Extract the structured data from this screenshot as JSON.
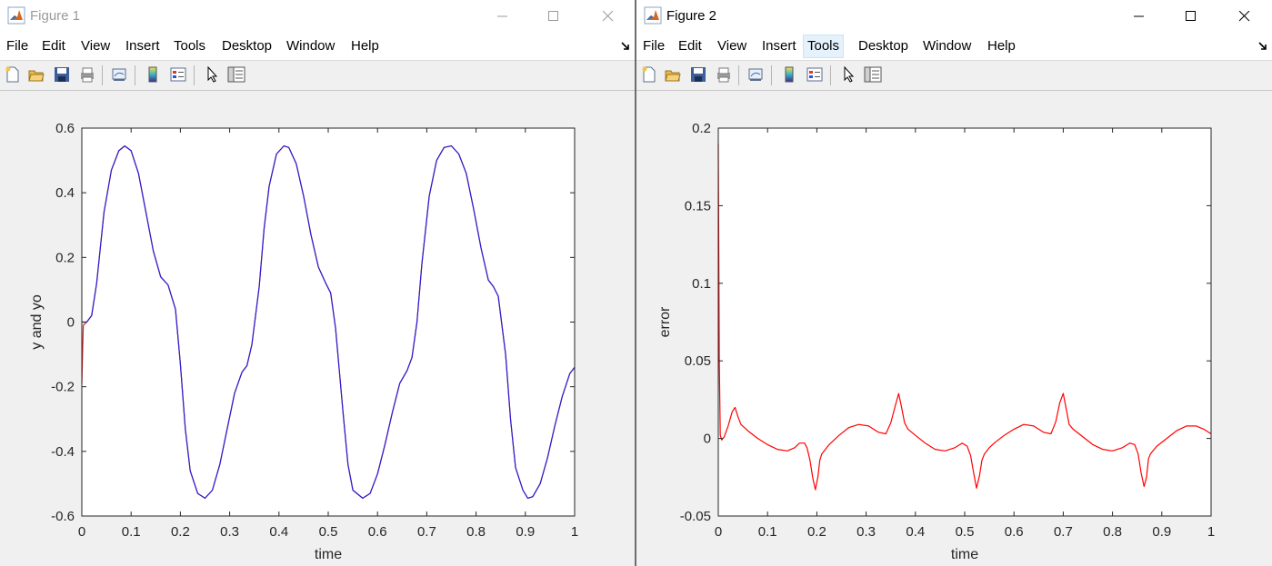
{
  "windows": [
    {
      "title": "Figure 1",
      "menu": [
        "File",
        "Edit",
        "View",
        "Insert",
        "Tools",
        "Desktop",
        "Window",
        "Help"
      ],
      "active_menu": null,
      "toolbar_icons": [
        "new-figure-icon",
        "open-file-icon",
        "save-icon",
        "print-icon",
        "link-plot-icon",
        "colorbar-icon",
        "legend-icon",
        "edit-plot-arrow-icon",
        "property-inspector-icon"
      ]
    },
    {
      "title": "Figure 2",
      "menu": [
        "File",
        "Edit",
        "View",
        "Insert",
        "Tools",
        "Desktop",
        "Window",
        "Help"
      ],
      "active_menu": "Tools",
      "toolbar_icons": [
        "new-figure-icon",
        "open-file-icon",
        "save-icon",
        "print-icon",
        "link-plot-icon",
        "colorbar-icon",
        "legend-icon",
        "edit-plot-arrow-icon",
        "property-inspector-icon"
      ]
    }
  ],
  "chart_data": [
    {
      "type": "line",
      "title": "",
      "xlabel": "time",
      "ylabel": "y and yo",
      "xlim": [
        0,
        1
      ],
      "ylim": [
        -0.6,
        0.6
      ],
      "xticks": [
        "0",
        "0.1",
        "0.2",
        "0.3",
        "0.4",
        "0.5",
        "0.6",
        "0.7",
        "0.8",
        "0.9",
        "1"
      ],
      "yticks": [
        "-0.6",
        "-0.4",
        "-0.2",
        "0",
        "0.2",
        "0.4",
        "0.6"
      ],
      "grid": false,
      "series": [
        {
          "color": "#e0201e",
          "x": [
            0,
            0.003,
            0.01,
            0.02,
            0.03,
            0.045,
            0.06,
            0.075,
            0.087,
            0.1,
            0.115,
            0.13,
            0.145,
            0.16,
            0.175,
            0.19,
            0.2,
            0.21,
            0.22,
            0.235,
            0.25,
            0.265,
            0.28,
            0.295,
            0.31,
            0.325,
            0.335,
            0.345,
            0.36,
            0.37,
            0.38,
            0.395,
            0.41,
            0.42,
            0.435,
            0.45,
            0.465,
            0.48,
            0.495,
            0.505,
            0.515,
            0.53,
            0.54,
            0.55,
            0.57,
            0.585,
            0.6,
            0.615,
            0.63,
            0.645,
            0.66,
            0.67,
            0.68,
            0.69,
            0.705,
            0.72,
            0.735,
            0.75,
            0.765,
            0.78,
            0.795,
            0.81,
            0.825,
            0.835,
            0.845,
            0.86,
            0.87,
            0.88,
            0.895,
            0.905,
            0.915,
            0.93,
            0.945,
            0.96,
            0.975,
            0.99,
            1.0
          ],
          "y": [
            -0.19,
            -0.01,
            0.0,
            0.02,
            0.12,
            0.34,
            0.47,
            0.53,
            0.545,
            0.53,
            0.46,
            0.34,
            0.22,
            0.14,
            0.115,
            0.04,
            -0.13,
            -0.33,
            -0.46,
            -0.53,
            -0.545,
            -0.52,
            -0.44,
            -0.33,
            -0.22,
            -0.155,
            -0.135,
            -0.07,
            0.11,
            0.29,
            0.42,
            0.52,
            0.545,
            0.54,
            0.49,
            0.39,
            0.27,
            0.17,
            0.12,
            0.09,
            -0.02,
            -0.28,
            -0.44,
            -0.52,
            -0.545,
            -0.53,
            -0.47,
            -0.38,
            -0.28,
            -0.19,
            -0.15,
            -0.11,
            0.0,
            0.18,
            0.39,
            0.5,
            0.54,
            0.545,
            0.52,
            0.46,
            0.35,
            0.23,
            0.13,
            0.11,
            0.08,
            -0.1,
            -0.3,
            -0.45,
            -0.52,
            -0.545,
            -0.54,
            -0.5,
            -0.42,
            -0.32,
            -0.23,
            -0.16,
            -0.14
          ]
        },
        {
          "color": "#2b1fd8",
          "x": [
            0,
            0.003,
            0.01,
            0.02,
            0.03,
            0.045,
            0.06,
            0.075,
            0.087,
            0.1,
            0.115,
            0.13,
            0.145,
            0.16,
            0.175,
            0.19,
            0.2,
            0.21,
            0.22,
            0.235,
            0.25,
            0.265,
            0.28,
            0.295,
            0.31,
            0.325,
            0.335,
            0.345,
            0.36,
            0.37,
            0.38,
            0.395,
            0.41,
            0.42,
            0.435,
            0.45,
            0.465,
            0.48,
            0.495,
            0.505,
            0.515,
            0.53,
            0.54,
            0.55,
            0.57,
            0.585,
            0.6,
            0.615,
            0.63,
            0.645,
            0.66,
            0.67,
            0.68,
            0.69,
            0.705,
            0.72,
            0.735,
            0.75,
            0.765,
            0.78,
            0.795,
            0.81,
            0.825,
            0.835,
            0.845,
            0.86,
            0.87,
            0.88,
            0.895,
            0.905,
            0.915,
            0.93,
            0.945,
            0.96,
            0.975,
            0.99,
            1.0
          ],
          "y": [
            0.0,
            0.0,
            0.0,
            0.02,
            0.12,
            0.34,
            0.47,
            0.53,
            0.545,
            0.53,
            0.46,
            0.34,
            0.22,
            0.14,
            0.115,
            0.04,
            -0.13,
            -0.33,
            -0.46,
            -0.53,
            -0.545,
            -0.52,
            -0.44,
            -0.33,
            -0.22,
            -0.155,
            -0.135,
            -0.07,
            0.11,
            0.29,
            0.42,
            0.52,
            0.545,
            0.54,
            0.49,
            0.39,
            0.27,
            0.17,
            0.12,
            0.09,
            -0.02,
            -0.28,
            -0.44,
            -0.52,
            -0.545,
            -0.53,
            -0.47,
            -0.38,
            -0.28,
            -0.19,
            -0.15,
            -0.11,
            0.0,
            0.18,
            0.39,
            0.5,
            0.54,
            0.545,
            0.52,
            0.46,
            0.35,
            0.23,
            0.13,
            0.11,
            0.08,
            -0.1,
            -0.3,
            -0.45,
            -0.52,
            -0.545,
            -0.54,
            -0.5,
            -0.42,
            -0.32,
            -0.23,
            -0.16,
            -0.14
          ]
        }
      ]
    },
    {
      "type": "line",
      "title": "",
      "xlabel": "time",
      "ylabel": "error",
      "xlim": [
        0,
        1
      ],
      "ylim": [
        -0.05,
        0.2
      ],
      "xticks": [
        "0",
        "0.1",
        "0.2",
        "0.3",
        "0.4",
        "0.5",
        "0.6",
        "0.7",
        "0.8",
        "0.9",
        "1"
      ],
      "yticks": [
        "-0.05",
        "0",
        "0.05",
        "0.1",
        "0.15",
        "0.2"
      ],
      "grid": false,
      "series": [
        {
          "color": "#ff0000",
          "x": [
            0,
            0.002,
            0.004,
            0.007,
            0.012,
            0.02,
            0.028,
            0.034,
            0.04,
            0.046,
            0.06,
            0.08,
            0.1,
            0.12,
            0.14,
            0.155,
            0.165,
            0.175,
            0.18,
            0.186,
            0.192,
            0.197,
            0.202,
            0.206,
            0.21,
            0.215,
            0.225,
            0.245,
            0.265,
            0.285,
            0.305,
            0.325,
            0.34,
            0.35,
            0.36,
            0.366,
            0.372,
            0.378,
            0.385,
            0.4,
            0.42,
            0.44,
            0.46,
            0.48,
            0.495,
            0.505,
            0.512,
            0.518,
            0.524,
            0.53,
            0.535,
            0.54,
            0.545,
            0.55,
            0.56,
            0.58,
            0.6,
            0.62,
            0.64,
            0.66,
            0.675,
            0.685,
            0.693,
            0.7,
            0.706,
            0.712,
            0.72,
            0.74,
            0.76,
            0.78,
            0.8,
            0.82,
            0.835,
            0.845,
            0.852,
            0.858,
            0.864,
            0.869,
            0.873,
            0.877,
            0.882,
            0.89,
            0.91,
            0.93,
            0.95,
            0.97,
            0.985,
            1.0
          ],
          "y": [
            0.19,
            0.05,
            0.002,
            -0.001,
            0.001,
            0.008,
            0.017,
            0.02,
            0.014,
            0.009,
            0.005,
            0.0,
            -0.004,
            -0.007,
            -0.008,
            -0.006,
            -0.003,
            -0.003,
            -0.006,
            -0.014,
            -0.026,
            -0.033,
            -0.025,
            -0.014,
            -0.01,
            -0.008,
            -0.004,
            0.002,
            0.007,
            0.009,
            0.008,
            0.004,
            0.003,
            0.01,
            0.022,
            0.029,
            0.02,
            0.01,
            0.006,
            0.002,
            -0.003,
            -0.007,
            -0.008,
            -0.006,
            -0.003,
            -0.005,
            -0.011,
            -0.022,
            -0.032,
            -0.024,
            -0.014,
            -0.01,
            -0.008,
            -0.006,
            -0.003,
            0.002,
            0.006,
            0.009,
            0.008,
            0.004,
            0.003,
            0.011,
            0.023,
            0.029,
            0.019,
            0.009,
            0.006,
            0.001,
            -0.004,
            -0.007,
            -0.008,
            -0.006,
            -0.003,
            -0.004,
            -0.01,
            -0.022,
            -0.031,
            -0.025,
            -0.013,
            -0.01,
            -0.008,
            -0.005,
            0.0,
            0.005,
            0.008,
            0.008,
            0.006,
            0.003
          ]
        }
      ]
    }
  ]
}
